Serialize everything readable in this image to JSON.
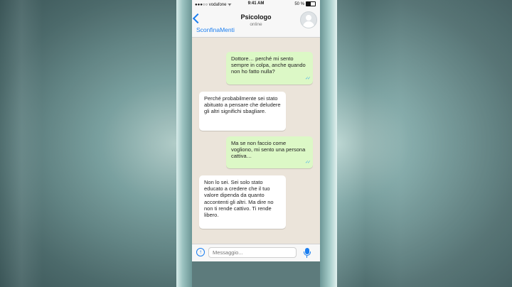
{
  "status_bar": {
    "carrier": "●●●○○ vodafone ᯤ",
    "time": "9:41 AM",
    "battery": "50 %"
  },
  "header": {
    "back_label": "SconfinaMenti",
    "contact_name": "Psicologo",
    "contact_status": "online"
  },
  "messages": [
    {
      "direction": "out",
      "text": "Dottore… perché mi sento sempre in colpa, anche quando non ho fatto nulla?",
      "read": true
    },
    {
      "direction": "in",
      "text": "Perché probabilmente sei stato abituato a pensare che deludere gli altri significhi sbagliare."
    },
    {
      "direction": "out",
      "text": "Ma se non faccio come vogliono, mi sento una persona cattiva…",
      "read": true
    },
    {
      "direction": "in",
      "text": "Non lo sei. Sei solo stato educato a credere che il tuo valore dipenda da quanto accontenti gli altri. Ma dire no non ti rende cattivo. Ti rende libero."
    }
  ],
  "composer": {
    "placeholder": "Messaggio..."
  },
  "colors": {
    "accent": "#1a7ef0",
    "outgoing_bubble": "#dcf8c6",
    "incoming_bubble": "#ffffff",
    "chat_background": "#ebe4da"
  }
}
